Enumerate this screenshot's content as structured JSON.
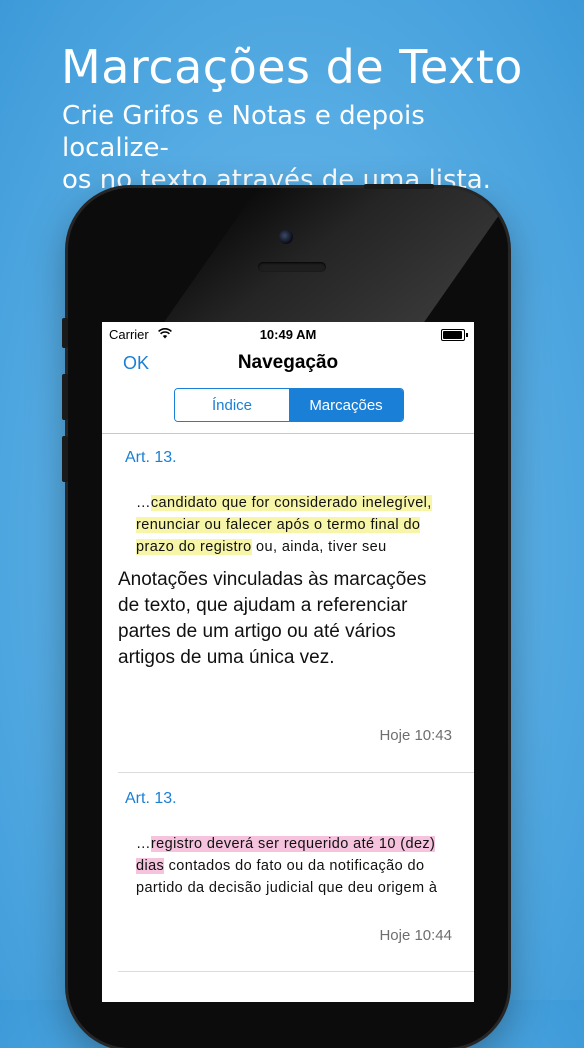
{
  "promo": {
    "title": "Marcações de Texto",
    "subtitle_line1": "Crie Grifos e Notas e depois localize-",
    "subtitle_line2": "os no texto através de uma lista."
  },
  "status_bar": {
    "carrier": "Carrier",
    "time": "10:49 AM"
  },
  "nav": {
    "ok_label": "OK",
    "title": "Navegação"
  },
  "segments": {
    "index_label": "Índice",
    "marks_label": "Marcações",
    "selected": "Marcações"
  },
  "notes": [
    {
      "article": "Art. 13.",
      "excerpt_prefix": "…",
      "excerpt_line1_hl": "candidato que for considerado inelegível,",
      "excerpt_line2_hl": "renunciar ou falecer após o termo final do",
      "excerpt_line3_hl": "prazo do registro",
      "excerpt_line3_rest": " ou, ainda, tiver seu",
      "highlight_color": "#f7f5a8",
      "note_line1": "Anotações vinculadas às marcações",
      "note_line2": "de texto, que ajudam a referenciar",
      "note_line3": "partes de um artigo ou até vários",
      "note_line4": "artigos de uma única vez.",
      "timestamp": "Hoje 10:43"
    },
    {
      "article": "Art. 13.",
      "excerpt_prefix": "…",
      "excerpt_line1_hl": "registro deverá ser requerido até 10 (dez)",
      "excerpt_line2_hl": "dias",
      "excerpt_line2_rest": " contados do fato ou da notificação do",
      "excerpt_line3_rest": "partido da decisão judicial que deu origem à",
      "highlight_color": "#f5c3dd",
      "timestamp": "Hoje 10:44"
    }
  ],
  "colors": {
    "accent": "#1a7fd6",
    "background": "#5cb0e6"
  }
}
